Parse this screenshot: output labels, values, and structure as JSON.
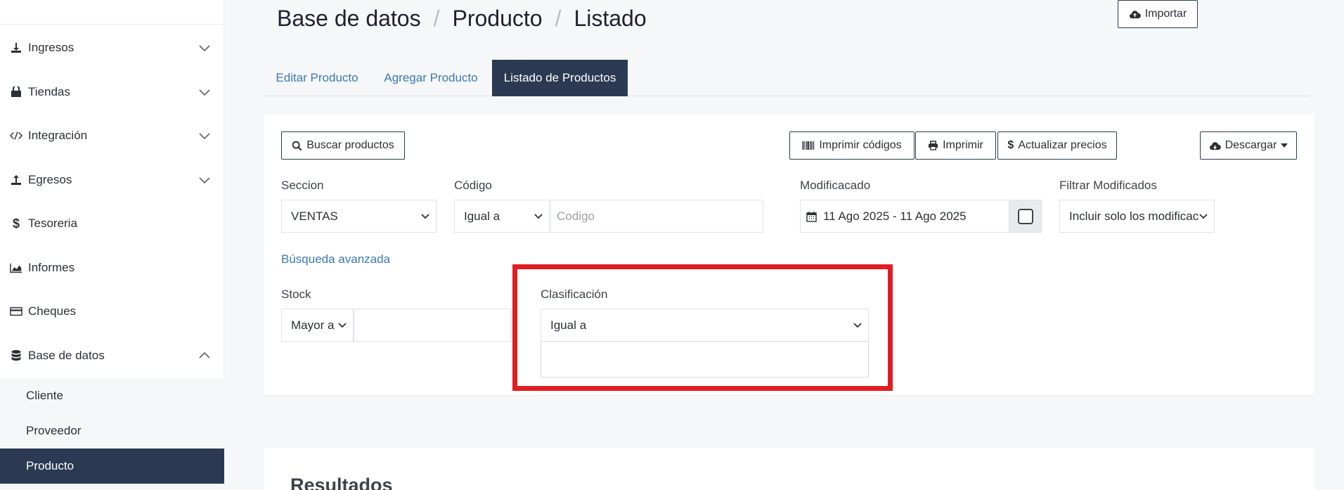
{
  "sidebar": {
    "items": [
      {
        "label": "Ingresos",
        "icon": "download-icon"
      },
      {
        "label": "Tiendas",
        "icon": "store-icon"
      },
      {
        "label": "Integración",
        "icon": "code-icon"
      },
      {
        "label": "Egresos",
        "icon": "upload-icon"
      },
      {
        "label": "Tesoreria",
        "icon": "dollar-icon"
      },
      {
        "label": "Informes",
        "icon": "chart-area-icon"
      },
      {
        "label": "Cheques",
        "icon": "credit-card-icon"
      },
      {
        "label": "Base de datos",
        "icon": "database-icon"
      }
    ],
    "subitems": [
      {
        "label": "Cliente"
      },
      {
        "label": "Proveedor"
      },
      {
        "label": "Producto",
        "active": true
      }
    ]
  },
  "breadcrumb": {
    "parts": [
      "Base de datos",
      "Producto",
      "Listado"
    ],
    "separator": "/"
  },
  "tabs": [
    {
      "label": "Editar Producto"
    },
    {
      "label": "Agregar Producto"
    },
    {
      "label": "Listado de Productos",
      "active": true
    }
  ],
  "toolbar": {
    "search_label": "Buscar productos",
    "print_codes_label": "Imprimir códigos",
    "print_label": "Imprimir",
    "update_prices_label": "Actualizar precios",
    "import_label": "Importar",
    "download_label": "Descargar"
  },
  "filters": {
    "seccion_label": "Seccion",
    "seccion_value": "VENTAS",
    "codigo_label": "Código",
    "codigo_operator": "Igual a",
    "codigo_placeholder": "Codigo",
    "modificado_label": "Modificacado",
    "modificado_range": "11 Ago 2025 - 11 Ago 2025",
    "filtrar_label": "Filtrar Modificados",
    "filtrar_value": "Incluir solo los modificac",
    "advanced_link": "Búsqueda avanzada",
    "stock_label": "Stock",
    "stock_operator": "Mayor a",
    "clasificacion_label": "Clasificación",
    "clasificacion_operator": "Igual a"
  },
  "results": {
    "title": "Resultados"
  },
  "colors": {
    "primary": "#2b3a52",
    "link": "#3a78b8",
    "highlight": "#e01e22"
  }
}
